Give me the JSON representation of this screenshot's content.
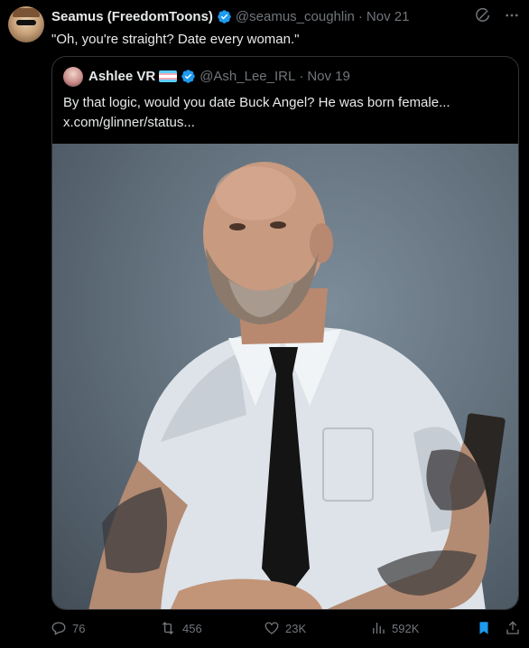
{
  "tweet": {
    "author_name": "Seamus (FreedomToons)",
    "handle": "@seamus_coughlin",
    "separator": "·",
    "date": "Nov 21",
    "text": "\"Oh, you're straight? Date every woman.\""
  },
  "quote": {
    "author_name": "Ashlee VR",
    "handle": "@Ash_Lee_IRL",
    "separator": "·",
    "date": "Nov 19",
    "text": "By that logic, would you date Buck Angel? He was born female...",
    "link": "x.com/glinner/status..."
  },
  "metrics": {
    "replies": "76",
    "reposts": "456",
    "likes": "23K",
    "views": "592K"
  },
  "colors": {
    "background": "#000000",
    "verified_blue": "#1d9bf0",
    "muted": "#71767b",
    "bookmark_active": "#1d9bf0",
    "flag": [
      "#5bcefa",
      "#f5a9b8",
      "#ffffff",
      "#f5a9b8",
      "#5bcefa"
    ]
  },
  "icons": {
    "verified": "verified-badge-icon",
    "grok": "grok-icon",
    "more": "more-icon",
    "reply": "reply-icon",
    "repost": "repost-icon",
    "like": "like-icon",
    "views": "views-icon",
    "bookmark": "bookmark-icon",
    "share": "share-icon"
  }
}
